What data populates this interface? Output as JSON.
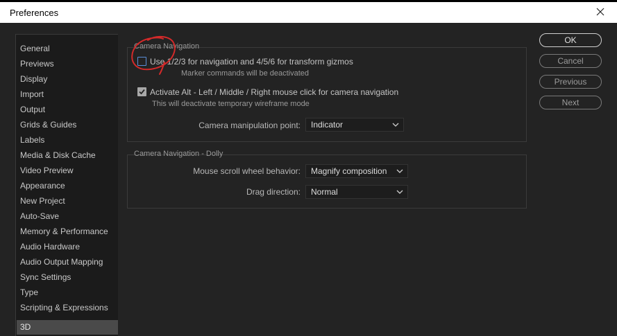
{
  "window": {
    "title": "Preferences"
  },
  "sidebar": {
    "items": [
      {
        "label": "General"
      },
      {
        "label": "Previews"
      },
      {
        "label": "Display"
      },
      {
        "label": "Import"
      },
      {
        "label": "Output"
      },
      {
        "label": "Grids & Guides"
      },
      {
        "label": "Labels"
      },
      {
        "label": "Media & Disk Cache"
      },
      {
        "label": "Video Preview"
      },
      {
        "label": "Appearance"
      },
      {
        "label": "New Project"
      },
      {
        "label": "Auto-Save"
      },
      {
        "label": "Memory & Performance"
      },
      {
        "label": "Audio Hardware"
      },
      {
        "label": "Audio Output Mapping"
      },
      {
        "label": "Sync Settings"
      },
      {
        "label": "Type"
      },
      {
        "label": "Scripting & Expressions"
      },
      {
        "label": "3D",
        "selected": true
      }
    ]
  },
  "camera_navigation": {
    "title": "Camera Navigation",
    "option1": {
      "label": "Use 1/2/3 for navigation and 4/5/6 for transform gizmos",
      "note": "Marker commands will be deactivated",
      "checked": false
    },
    "option2": {
      "label": "Activate Alt - Left / Middle / Right mouse click for camera navigation",
      "note": "This will deactivate temporary wireframe mode",
      "checked": true
    },
    "manipulation_point": {
      "label": "Camera manipulation point:",
      "value": "Indicator"
    }
  },
  "camera_navigation_dolly": {
    "title": "Camera Navigation - Dolly",
    "scroll_behavior": {
      "label": "Mouse scroll wheel behavior:",
      "value": "Magnify composition"
    },
    "drag_direction": {
      "label": "Drag direction:",
      "value": "Normal"
    }
  },
  "buttons": {
    "ok": "OK",
    "cancel": "Cancel",
    "previous": "Previous",
    "next": "Next"
  },
  "colors": {
    "dialog_background": "#232323",
    "sidebar_background": "#1b1b1b",
    "selected_item": "#4a4a4a",
    "annotation_stroke": "#d42a2a"
  }
}
